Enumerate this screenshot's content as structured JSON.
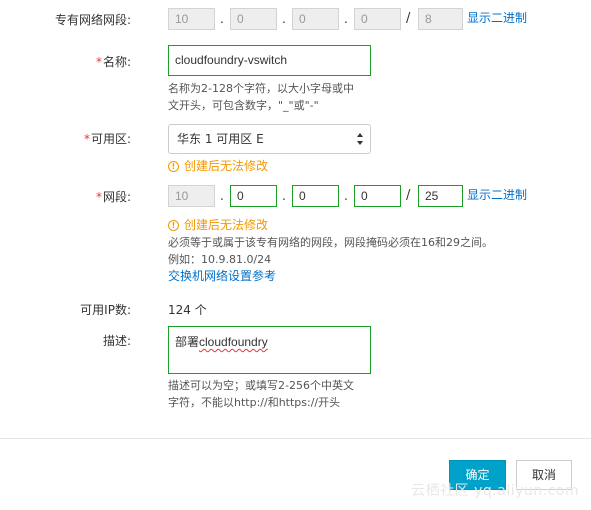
{
  "vpc_cidr": {
    "label": "专有网络网段:",
    "octets": [
      "10",
      "0",
      "0",
      "0"
    ],
    "mask": "8",
    "binary_link": "显示二进制"
  },
  "name": {
    "required_mark": "*",
    "label": "名称:",
    "value": "cloudfoundry-vswitch",
    "help_line1": "名称为2-128个字符，以大小字母或中",
    "help_line2": "文开头，可包含数字，\"_\"或\"-\""
  },
  "zone": {
    "required_mark": "*",
    "label": "可用区:",
    "selected": "华东 1 可用区 E",
    "warning": "创建后无法修改"
  },
  "cidr": {
    "required_mark": "*",
    "label": "网段:",
    "octets": [
      "10",
      "0",
      "0",
      "0"
    ],
    "mask": "25",
    "binary_link": "显示二进制",
    "warning": "创建后无法修改",
    "help_line1": "必须等于或属于该专有网络的网段，网段掩码必须在16和29之间。",
    "help_line2": "例如：10.9.81.0/24",
    "ref_link": "交换机网络设置参考"
  },
  "available_ip": {
    "label": "可用IP数:",
    "value": "124 个"
  },
  "description": {
    "label": "描述:",
    "value_prefix": "部署",
    "value_word": "cloudfoundry",
    "help_line1": "描述可以为空；或填写2-256个中英文",
    "help_line2": "字符，不能以http://和https://开头"
  },
  "footer": {
    "confirm": "确定",
    "cancel": "取消"
  },
  "watermark": "云栖社区 yq.aliyun.com",
  "colors": {
    "accent_green": "#1a9f29",
    "link_blue": "#0070cc",
    "warning_orange": "#f39800",
    "required_red": "#e4393c",
    "primary_button": "#00a2ca"
  }
}
